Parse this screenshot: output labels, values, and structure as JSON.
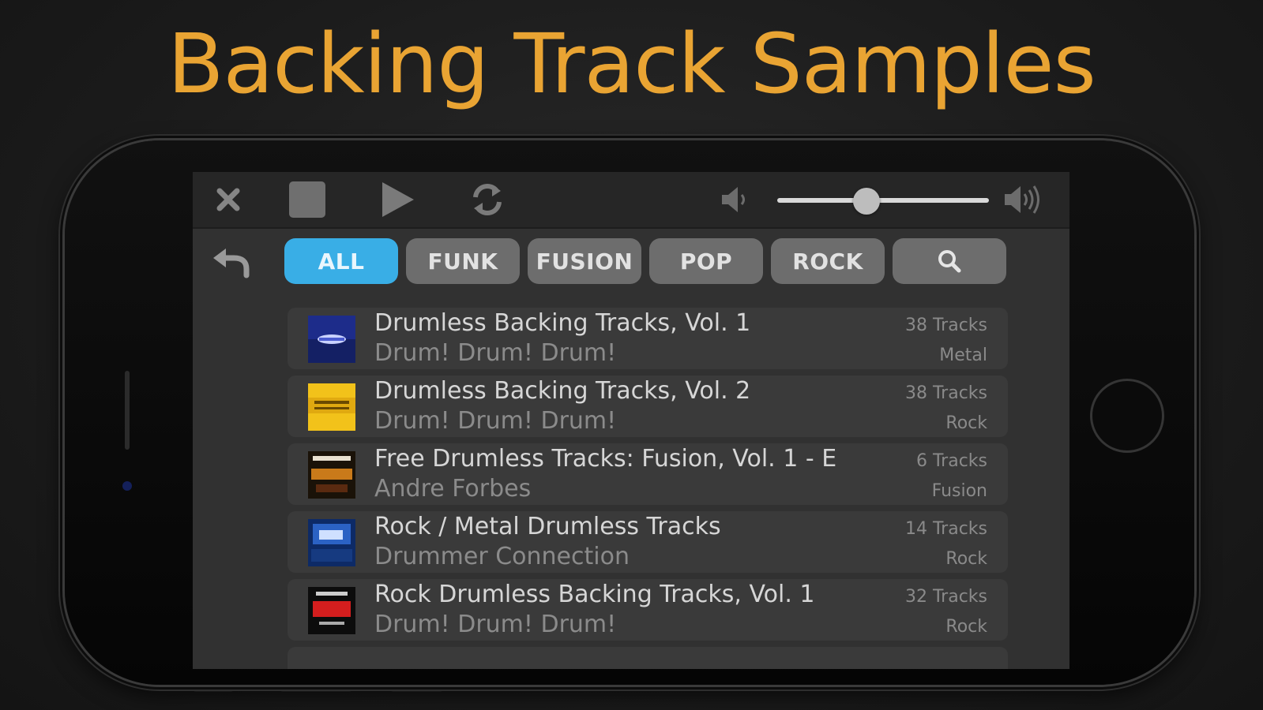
{
  "headline": "Backing Track Samples",
  "colors": {
    "accent": "#e9a433",
    "active_chip": "#39aee6"
  },
  "toolbar": {
    "icons": [
      "close-icon",
      "stop-icon",
      "play-icon",
      "repeat-icon",
      "volume-low-icon",
      "volume-high-icon"
    ],
    "volume_level": 0.42
  },
  "filters": {
    "back_icon": "back-arrow-icon",
    "chips": [
      {
        "label": "ALL",
        "active": true
      },
      {
        "label": "FUNK",
        "active": false
      },
      {
        "label": "FUSION",
        "active": false
      },
      {
        "label": "POP",
        "active": false
      },
      {
        "label": "ROCK",
        "active": false
      }
    ],
    "search_icon": "search-icon"
  },
  "tracks": [
    {
      "title": "Drumless Backing Tracks, Vol. 1",
      "artist": "Drum! Drum! Drum!",
      "count": "38 Tracks",
      "genre": "Metal"
    },
    {
      "title": "Drumless Backing Tracks, Vol. 2",
      "artist": "Drum! Drum! Drum!",
      "count": "38 Tracks",
      "genre": "Rock"
    },
    {
      "title": "Free Drumless Tracks: Fusion, Vol. 1 - E",
      "artist": "Andre Forbes",
      "count": "6 Tracks",
      "genre": "Fusion"
    },
    {
      "title": "Rock / Metal Drumless Tracks",
      "artist": "Drummer Connection",
      "count": "14 Tracks",
      "genre": "Rock"
    },
    {
      "title": "Rock Drumless Backing Tracks, Vol. 1",
      "artist": "Drum! Drum! Drum!",
      "count": "32 Tracks",
      "genre": "Rock"
    }
  ]
}
